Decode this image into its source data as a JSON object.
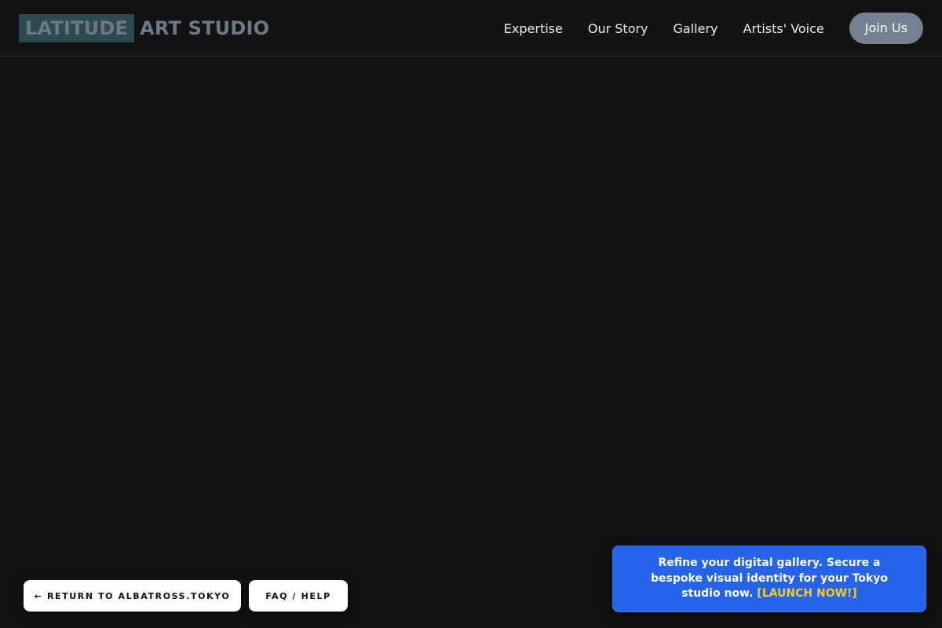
{
  "header": {
    "logo": {
      "highlight": "LATITUDE",
      "rest": "ART STUDIO"
    },
    "nav": [
      {
        "label": "Expertise"
      },
      {
        "label": "Our Story"
      },
      {
        "label": "Gallery"
      },
      {
        "label": "Artists' Voice"
      }
    ],
    "join_label": "Join Us"
  },
  "footer": {
    "return_label": "← RETURN TO ALBATROSS.TOKYO",
    "faq_label": "FAQ / HELP"
  },
  "promo": {
    "text": "Refine your digital gallery. Secure a bespoke visual identity for your Tokyo studio now. ",
    "cta": "[LAUNCH NOW!]"
  },
  "colors": {
    "background": "#111111",
    "logo_highlight_bg": "#2f4a4d",
    "logo_text": "#6b7a86",
    "join_button": "#738192",
    "promo_bg": "#2563eb",
    "promo_cta": "#facc15"
  }
}
